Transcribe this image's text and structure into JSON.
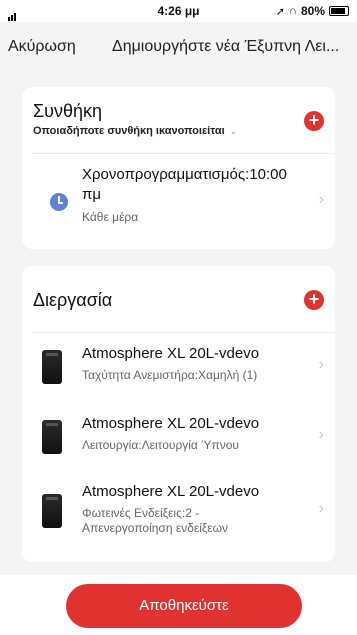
{
  "status_bar": {
    "time": "4:26 μμ",
    "battery": "80%"
  },
  "nav": {
    "cancel": "Ακύρωση",
    "title": "Δημιουργήστε νέα Έξυπνη Λει..."
  },
  "condition": {
    "title": "Συνθήκη",
    "subtitle": "Οποιαδήποτε συνθήκη ικανοποιείται",
    "add_icon": "plus-icon",
    "item": {
      "icon": "clock-icon",
      "title_line1": "Χρονοπρογραμματισμός:10:00",
      "title_line2": "πμ",
      "subtitle": "Κάθε μέρα"
    }
  },
  "process": {
    "title": "Διεργασία",
    "add_icon": "plus-icon",
    "items": [
      {
        "title": "Atmosphere XL 20L-vdevo",
        "sub1": "Ταχύτητα Ανεμιστήρα:Χαμηλή (1)",
        "sub2": ""
      },
      {
        "title": "Atmosphere XL 20L-vdevo",
        "sub1": "Λειτουργία:Λειτουργία Ύπνου",
        "sub2": ""
      },
      {
        "title": "Atmosphere XL 20L-vdevo",
        "sub1": "Φωτεινές Ενδείξεις:2 -",
        "sub2": "Απενεργοποίηση ενδείξεων"
      }
    ]
  },
  "footer": {
    "save_label": "Αποθηκεύστε"
  },
  "colors": {
    "accent": "#e0322f",
    "clock": "#5b84d6"
  }
}
